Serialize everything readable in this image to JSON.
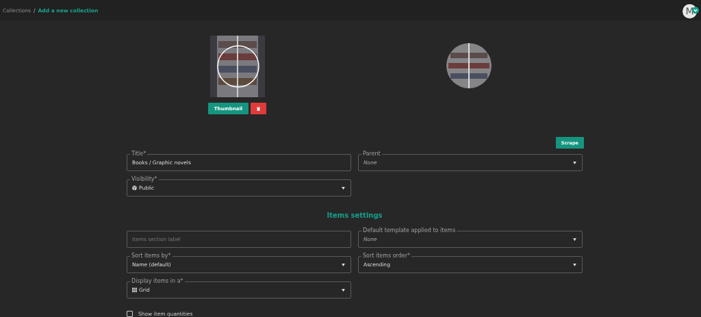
{
  "breadcrumb": [
    {
      "label": "Collections",
      "current": false
    },
    {
      "label": "Add a new collection",
      "current": true
    }
  ],
  "breadcrumb_separator": "/",
  "user": {
    "initial": "M"
  },
  "images": {
    "thumbnail_button": "Thumbnail"
  },
  "scrape_button": "Scrape",
  "main_fields": [
    [
      {
        "label": "Title*",
        "value": "Books / Graphic novels",
        "kind": "text",
        "empty": false
      },
      {
        "label": "Parent",
        "value": "None",
        "kind": "select",
        "empty": true
      }
    ],
    [
      {
        "label": "Visibility*",
        "value": "Public",
        "kind": "select",
        "empty": false
      }
    ]
  ],
  "items_heading": "Items settings",
  "items_fields": [
    [
      {
        "placeholder": "Items section label",
        "kind": "text"
      },
      {
        "label": "Default template applied to items",
        "value": "None",
        "kind": "select",
        "empty": true
      }
    ],
    [
      {
        "label": "Sort items by*",
        "value": "Name (default)",
        "kind": "select",
        "empty": false
      },
      {
        "label": "Sort items order*",
        "value": "Ascending",
        "kind": "select",
        "empty": false
      }
    ],
    [
      {
        "label": "Display items in a*",
        "value": "Grid",
        "kind": "select",
        "empty": false
      }
    ]
  ],
  "checkbox": {
    "label": "Show item quantities",
    "checked": false
  }
}
